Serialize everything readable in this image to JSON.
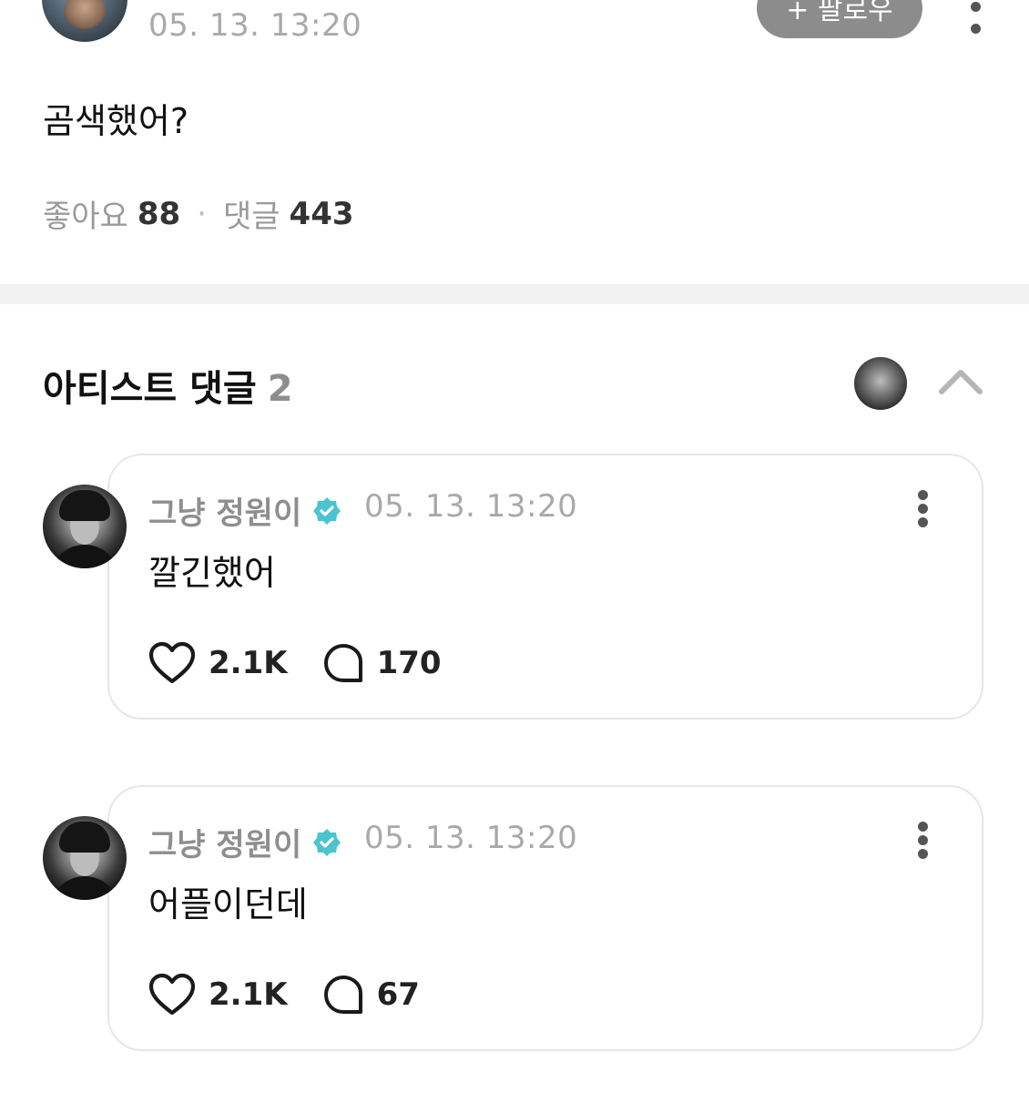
{
  "post": {
    "date": "05. 13. 13:20",
    "follow_label": "+ 팔로우",
    "text": "곰색했어?",
    "likes_label": "좋아요",
    "likes_count": "88",
    "separator": "·",
    "comments_label": "댓글",
    "comments_count": "443"
  },
  "artist_comments": {
    "title": "아티스트 댓글",
    "count": "2",
    "items": [
      {
        "author": "그냥 정원이",
        "date": "05. 13. 13:20",
        "text": "깔긴했어",
        "likes": "2.1K",
        "replies": "170"
      },
      {
        "author": "그냥 정원이",
        "date": "05. 13. 13:20",
        "text": "어플이던데",
        "likes": "2.1K",
        "replies": "67"
      }
    ]
  },
  "colors": {
    "verified": "#4cc4cf",
    "follow_bg": "#8c8c8c",
    "muted_text": "#a9a9a9"
  },
  "icons": [
    "more-vertical-icon",
    "verified-badge-icon",
    "heart-icon",
    "comment-bubble-icon",
    "chevron-up-icon"
  ]
}
